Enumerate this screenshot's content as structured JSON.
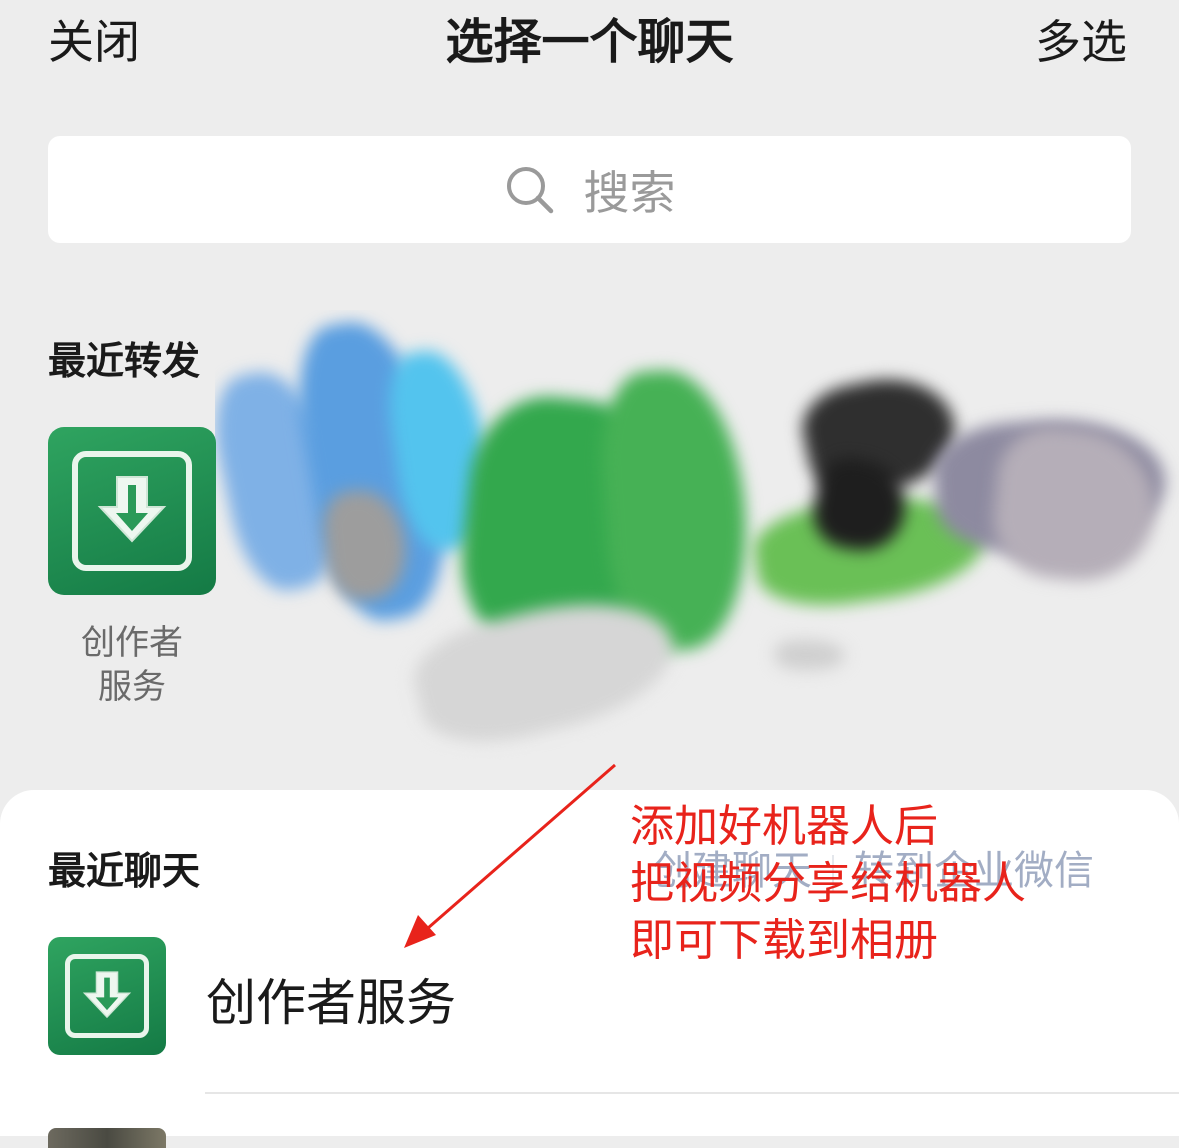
{
  "header": {
    "close_label": "关闭",
    "title": "选择一个聊天",
    "multi_select_label": "多选"
  },
  "search": {
    "icon": "search-icon",
    "placeholder": "搜索"
  },
  "recent_forward": {
    "title": "最近转发",
    "items": [
      {
        "label": "创作者\n服务",
        "icon": "download-icon",
        "color": "#1f8f52"
      }
    ]
  },
  "recent_chats": {
    "title": "最近聊天",
    "create_chat_label": "创建聊天",
    "forward_to_work_wechat_label": "转到企业微信",
    "items": [
      {
        "name": "创作者服务",
        "icon": "download-icon"
      }
    ]
  },
  "annotation": {
    "lines": [
      "添加好机器人后",
      "把视频分享给机器人",
      "即可下载到相册"
    ],
    "color": "#e8231b"
  }
}
